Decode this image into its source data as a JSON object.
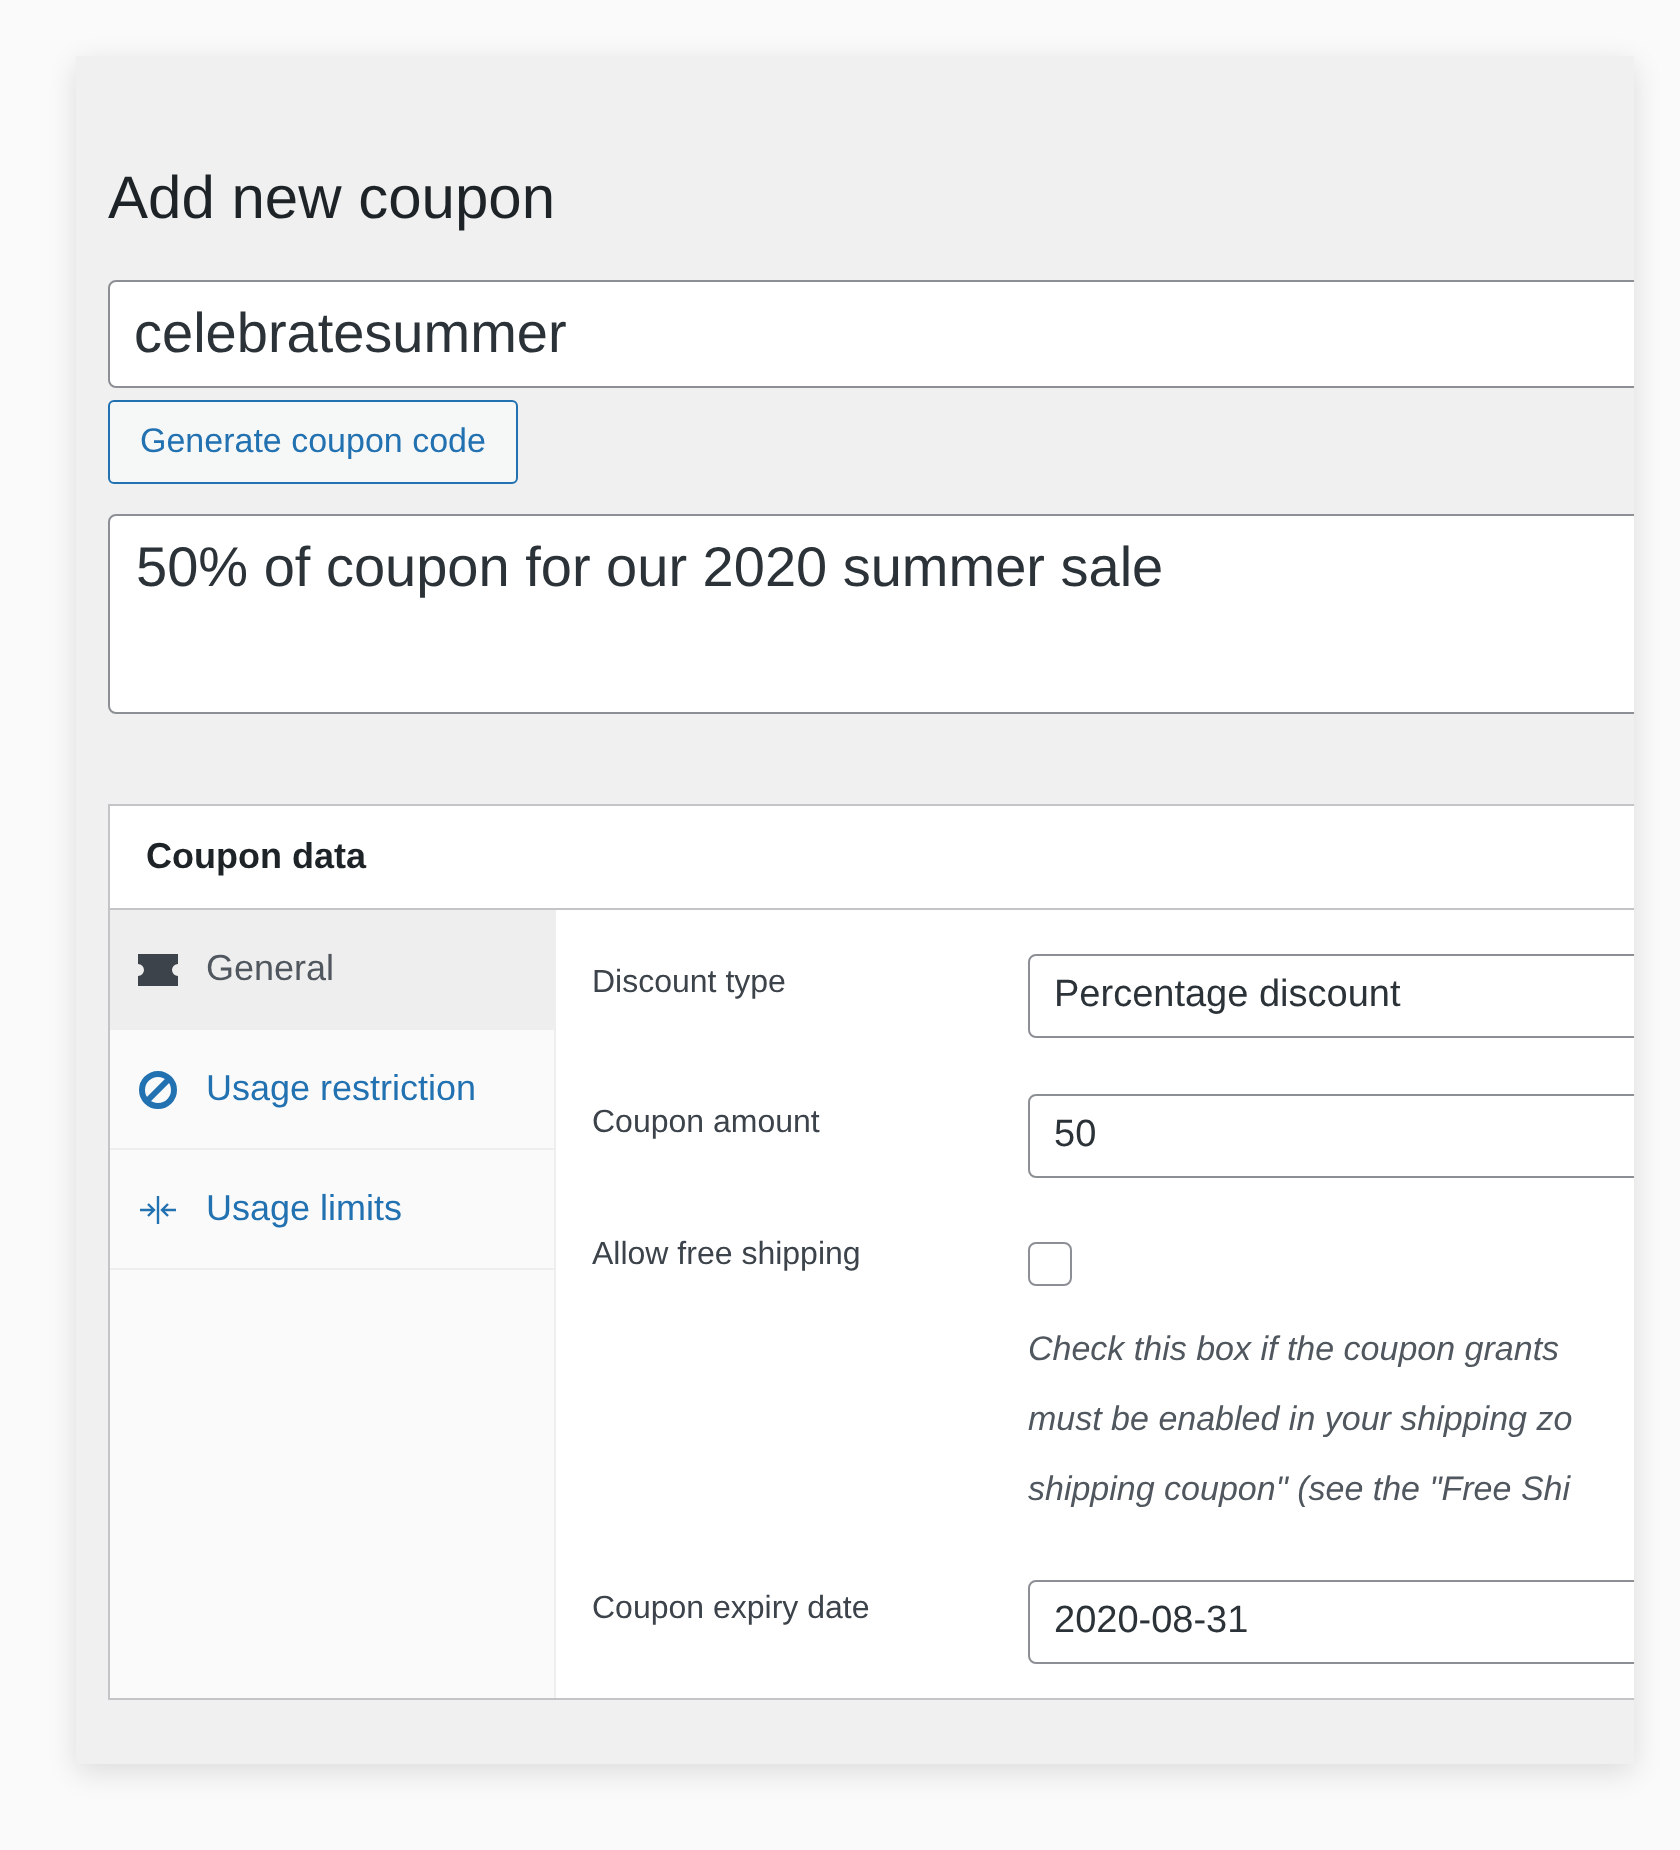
{
  "page_title": "Add new coupon",
  "coupon_code": {
    "value": "celebratesummer"
  },
  "generate_button": "Generate coupon code",
  "description": {
    "value": "50% of coupon for our 2020 summer sale"
  },
  "coupon_data": {
    "title": "Coupon data",
    "tabs": [
      {
        "label": "General",
        "kind": "ticket",
        "selected": true
      },
      {
        "label": "Usage restriction",
        "kind": "restriction",
        "selected": false
      },
      {
        "label": "Usage limits",
        "kind": "limits",
        "selected": false
      }
    ],
    "fields": [
      {
        "kind": "select",
        "label": "Discount type",
        "value": "Percentage discount"
      },
      {
        "kind": "text",
        "label": "Coupon amount",
        "value": "50"
      },
      {
        "kind": "checkbox",
        "label": "Allow free shipping",
        "checked": false,
        "help": [
          "Check this box if the coupon grants",
          "must be enabled in your shipping zo",
          "shipping coupon\" (see the \"Free Shi"
        ]
      },
      {
        "kind": "text",
        "label": "Coupon expiry date",
        "value": "2020-08-31"
      }
    ]
  }
}
